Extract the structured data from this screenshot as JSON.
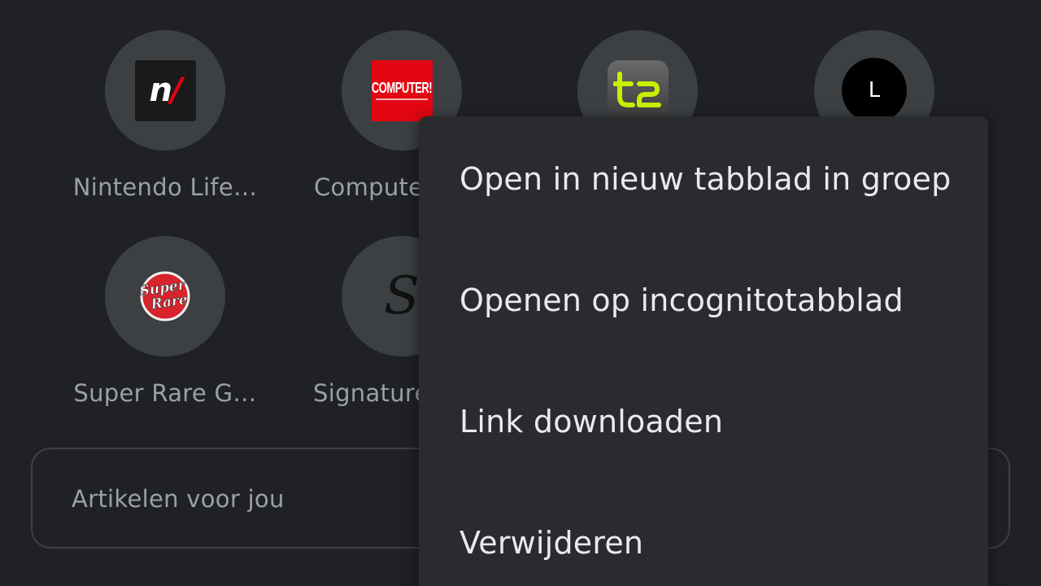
{
  "shortcuts": [
    {
      "label": "Nintendo Life…",
      "icon": "nintendo-life-favicon",
      "icon_text": "nl"
    },
    {
      "label": "Compute",
      "icon": "computer-favicon",
      "icon_text": "COMPUTER!"
    },
    {
      "label": "",
      "icon": "t3-favicon",
      "icon_text": "t3"
    },
    {
      "label": "",
      "icon": "l-favicon",
      "icon_text": "L"
    },
    {
      "label": "Super Rare G…",
      "icon": "super-rare-favicon",
      "icon_text": "Super Rare"
    },
    {
      "label": "Signature",
      "icon": "signature-favicon",
      "icon_text": "S"
    }
  ],
  "articles": {
    "label": "Artikelen voor jou"
  },
  "context_menu": {
    "items": [
      {
        "label": "Open in nieuw tabblad in groep"
      },
      {
        "label": "Openen op incognitotabblad"
      },
      {
        "label": "Link downloaden"
      },
      {
        "label": "Verwijderen"
      }
    ]
  },
  "colors": {
    "background": "#202124",
    "tile_circle": "#3c4043",
    "menu_background": "#2a2b2e",
    "menu_text": "#e8eaed",
    "label_text": "#9aa0a6"
  }
}
